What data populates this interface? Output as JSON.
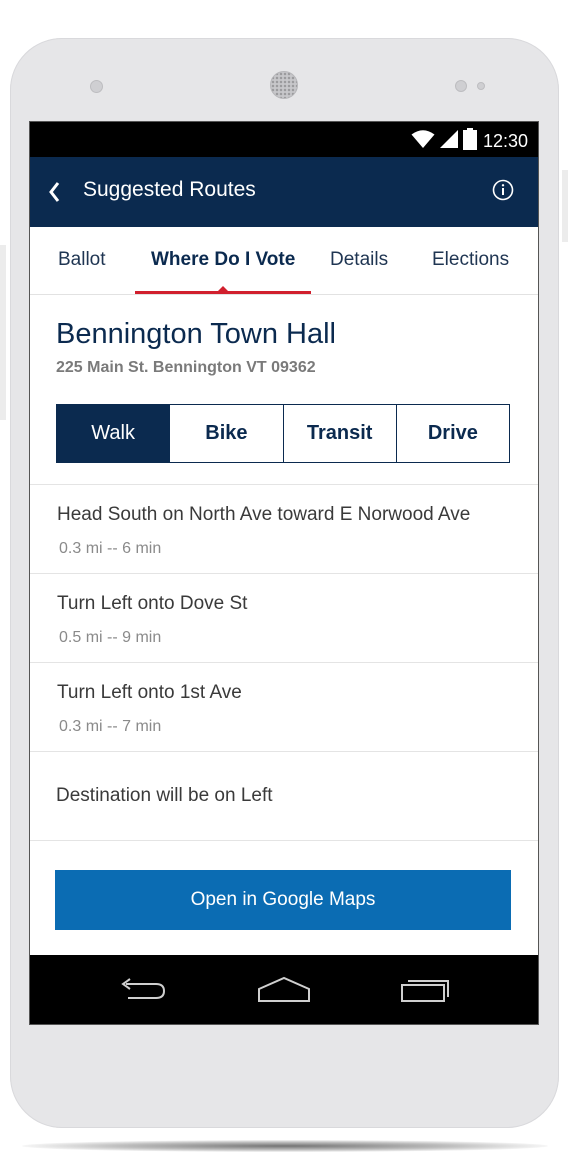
{
  "status_bar": {
    "time": "12:30",
    "icons": [
      "wifi-icon",
      "signal-icon",
      "battery-icon"
    ]
  },
  "app_bar": {
    "title": "Suggested Routes",
    "back_icon": "chevron-left-icon",
    "info_icon": "info-icon"
  },
  "tabs": [
    {
      "label": "Ballot"
    },
    {
      "label": "Where Do I Vote",
      "active": true
    },
    {
      "label": "Details"
    },
    {
      "label": "Elections"
    }
  ],
  "location": {
    "name": "Bennington Town Hall",
    "address": "225 Main St. Bennington VT 09362"
  },
  "modes": [
    {
      "label": "Walk",
      "active": true
    },
    {
      "label": "Bike"
    },
    {
      "label": "Transit"
    },
    {
      "label": "Drive"
    }
  ],
  "steps": [
    {
      "text": "Head South on North Ave toward E Norwood Ave",
      "meta": "0.3 mi -- 6 min"
    },
    {
      "text": "Turn Left onto Dove St",
      "meta": "0.5 mi -- 9 min"
    },
    {
      "text": "Turn Left onto 1st Ave",
      "meta": "0.3 mi -- 7 min"
    },
    {
      "text": "Destination will be on Left"
    }
  ],
  "actions": {
    "open_maps_label": "Open in Google Maps"
  },
  "nav_bar": {
    "icons": [
      "back-nav-icon",
      "home-nav-icon",
      "recents-nav-icon"
    ]
  },
  "colors": {
    "navy": "#0b2a4f",
    "accent_red": "#d11f2d",
    "button_blue": "#0b6cb3"
  }
}
